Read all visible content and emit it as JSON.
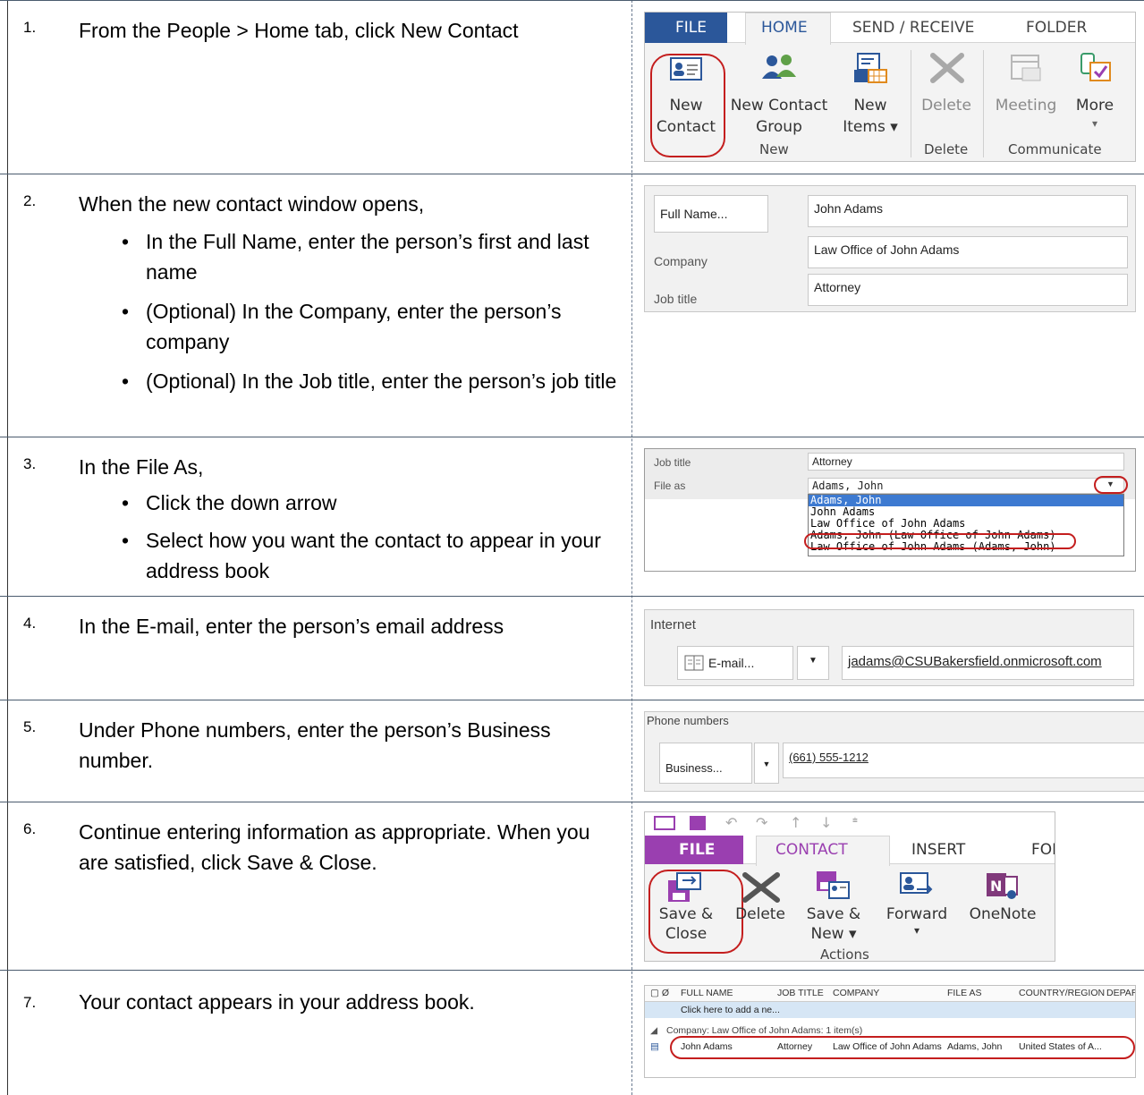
{
  "steps": [
    {
      "num": "1.",
      "text": "From the People > Home tab, click New Contact"
    },
    {
      "num": "2.",
      "text": "When the new contact window opens,",
      "bullets": [
        "In the Full Name, enter the person’s first and last name",
        "(Optional) In the Company, enter the person’s company",
        "(Optional) In the Job title, enter the person’s job title"
      ]
    },
    {
      "num": "3.",
      "text": "In the File As,",
      "bullets": [
        "Click the down arrow",
        "Select how you want the contact to appear in your address book"
      ]
    },
    {
      "num": "4.",
      "text": "In the E-mail, enter the person’s email address"
    },
    {
      "num": "5.",
      "text": "Under Phone numbers, enter the person’s Business number."
    },
    {
      "num": "6.",
      "text": "Continue entering information as appropriate. When you are satisfied, click Save & Close."
    },
    {
      "num": "7.",
      "text": "Your contact appears in your address book."
    }
  ],
  "shot1": {
    "tabs": [
      "FILE",
      "HOME",
      "SEND / RECEIVE",
      "FOLDER"
    ],
    "buttons": [
      {
        "line1": "New",
        "line2": "Contact",
        "icon": "contact-card-icon"
      },
      {
        "line1": "New Contact",
        "line2": "Group",
        "icon": "contact-group-icon"
      },
      {
        "line1": "New",
        "line2": "Items ▾",
        "icon": "new-items-icon"
      },
      {
        "line1": "Delete",
        "line2": "",
        "icon": "delete-x-icon"
      },
      {
        "line1": "Meeting",
        "line2": "",
        "icon": "meeting-icon"
      },
      {
        "line1": "More",
        "line2": "▾",
        "icon": "more-icon"
      }
    ],
    "groups": [
      "New",
      "Delete",
      "Communicate"
    ]
  },
  "shot2": {
    "fullname_button": "Full Name...",
    "fullname_value": "John Adams",
    "company_label": "Company",
    "company_value": "Law Office of John Adams",
    "jobtitle_label": "Job title",
    "jobtitle_value": "Attorney"
  },
  "shot3": {
    "jobtitle_label": "Job title",
    "jobtitle_value": "Attorney",
    "fileas_label": "File as",
    "fileas_value": "Adams, John",
    "options": [
      "Adams, John",
      "John Adams",
      "Law Office of John Adams",
      "Adams, John (Law Office of John Adams)",
      "Law Office of John Adams (Adams, John)"
    ]
  },
  "shot4": {
    "section": "Internet",
    "button": "E-mail...",
    "value": "jadams@CSUBakersfield.onmicrosoft.com"
  },
  "shot5": {
    "section": "Phone numbers",
    "button": "Business...",
    "value": "(661) 555-1212"
  },
  "shot6": {
    "tabs": [
      "FILE",
      "CONTACT",
      "INSERT",
      "FOI"
    ],
    "buttons": [
      {
        "line1": "Save &",
        "line2": "Close",
        "icon": "save-close-icon"
      },
      {
        "line1": "Delete",
        "line2": "",
        "icon": "delete-x-icon"
      },
      {
        "line1": "Save &",
        "line2": "New ▾",
        "icon": "save-new-icon"
      },
      {
        "line1": "Forward",
        "line2": "▾",
        "icon": "forward-icon"
      },
      {
        "line1": "OneNote",
        "line2": "",
        "icon": "onenote-icon"
      }
    ],
    "group": "Actions"
  },
  "shot7": {
    "headers": [
      "FULL NAME",
      "JOB TITLE",
      "COMPANY",
      "FILE AS",
      "COUNTRY/REGION",
      "DEPAR"
    ],
    "add_row": "Click here to add a ne...",
    "group_row": "Company: Law Office of John Adams: 1 item(s)",
    "row": [
      "John Adams",
      "Attorney",
      "Law Office of John Adams",
      "Adams, John",
      "United States of A..."
    ]
  },
  "colors": {
    "accent_blue": "#2b579a",
    "annotation_red": "#c41e1e",
    "onenote_purple": "#80397b",
    "row_border": "#4a5b6e"
  }
}
